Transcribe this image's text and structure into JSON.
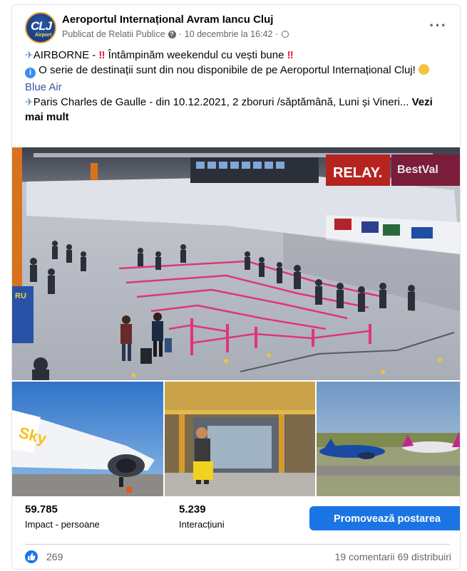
{
  "post": {
    "page_name": "Aeroportul Internațional Avram Iancu Cluj",
    "avatar_text": "CLJ",
    "avatar_sub": "Airport",
    "published_by": "Publicat de Relatii Publice",
    "date": "10 decembrie la 16:42",
    "more_label": "···"
  },
  "body": {
    "line1_prefix": "AIRBORNE - ",
    "line1_bang": "‼",
    "line1_text": " Întâmpinăm weekendul cu vești bune ",
    "line2_info": "i",
    "line2_text": " O serie de destinații sunt din nou disponibile de pe Aeroportul Internațional Cluj! ",
    "airline": "Blue Air",
    "line3_text": "Paris Charles de Gaulle  - din 10.12.2021, 2 zboruri /săptămână, Luni și Vineri... ",
    "see_more": "Vezi mai mult",
    "plane_glyph": "✈"
  },
  "photo": {
    "sign_relay": "RELAY.",
    "sign_bestval": "BestVal",
    "sign_ru": "RU",
    "thumb1_brand": "Sky"
  },
  "stats": {
    "reach_value": "59.785",
    "reach_label": "Impact - persoane",
    "engagement_value": "5.239",
    "engagement_label": "Interacțiuni",
    "promote_label": "Promovează postarea"
  },
  "footer": {
    "likes": "269",
    "comments": "19 comentarii",
    "shares": "69 distribuiri"
  },
  "colors": {
    "accent": "#1b74e4",
    "link": "#385898",
    "muted": "#65676b"
  }
}
